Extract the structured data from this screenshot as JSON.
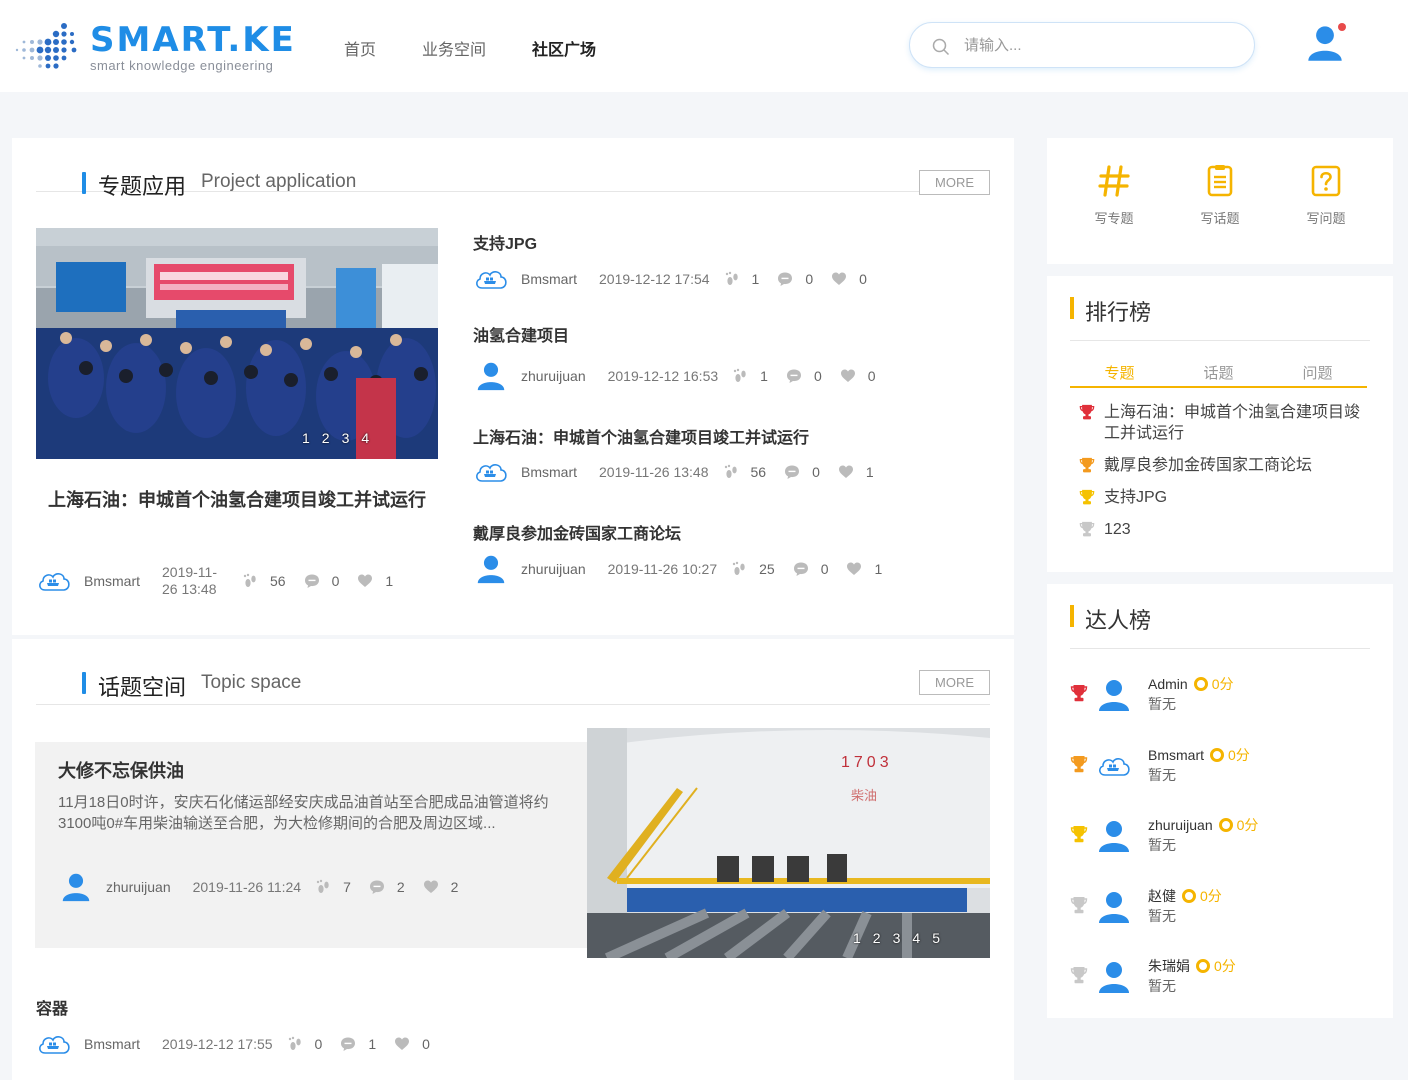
{
  "header": {
    "logo_word": "SMART.KE",
    "logo_sub": "smart  knowledge  engineering",
    "nav": [
      "首页",
      "业务空间",
      "社区广场"
    ],
    "search_placeholder": "请输入..."
  },
  "project": {
    "title": "专题应用",
    "subtitle": "Project application",
    "more": "MORE",
    "carousel_pages": [
      "1",
      "2",
      "3",
      "4"
    ],
    "featured": {
      "title": "上海石油：申城首个油氢合建项目竣工并试运行",
      "author": "Bmsmart",
      "date": "2019-11-26 13:48",
      "views": "56",
      "comments": "0",
      "likes": "1"
    },
    "items": [
      {
        "title": "支持JPG",
        "author": "Bmsmart",
        "date": "2019-12-12 17:54",
        "views": "1",
        "comments": "0",
        "likes": "0"
      },
      {
        "title": "油氢合建项目",
        "author": "zhuruijuan",
        "date": "2019-12-12 16:53",
        "views": "1",
        "comments": "0",
        "likes": "0"
      },
      {
        "title": "上海石油：申城首个油氢合建项目竣工并试运行",
        "author": "Bmsmart",
        "date": "2019-11-26 13:48",
        "views": "56",
        "comments": "0",
        "likes": "1"
      },
      {
        "title": "戴厚良参加金砖国家工商论坛",
        "author": "zhuruijuan",
        "date": "2019-11-26 10:27",
        "views": "25",
        "comments": "0",
        "likes": "1"
      }
    ]
  },
  "topic": {
    "title": "话题空间",
    "subtitle": "Topic space",
    "more": "MORE",
    "featured": {
      "title": "大修不忘保供油",
      "text": "11月18日0时许，安庆石化储运部经安庆成品油首站至合肥成品油管道将约3100吨0#车用柴油输送至合肥，为大检修期间的合肥及周边区域...",
      "author": "zhuruijuan",
      "date": "2019-11-26 11:24",
      "views": "7",
      "comments": "2",
      "likes": "2"
    },
    "photo_label_1": "1703",
    "photo_label_2": "柴油",
    "carousel_pages": [
      "1",
      "2",
      "3",
      "4",
      "5"
    ],
    "items": [
      {
        "title": "容器",
        "author": "Bmsmart",
        "date": "2019-12-12 17:55",
        "views": "0",
        "comments": "1",
        "likes": "0"
      }
    ]
  },
  "actions": [
    "写专题",
    "写话题",
    "写问题"
  ],
  "ranking": {
    "title": "排行榜",
    "tabs": [
      "专题",
      "话题",
      "问题"
    ],
    "items": [
      "上海石油：申城首个油氢合建项目竣工并试运行",
      "戴厚良参加金砖国家工商论坛",
      "支持JPG",
      "123"
    ]
  },
  "experts": {
    "title": "达人榜",
    "items": [
      {
        "name": "Admin",
        "score": "0分",
        "status": "暂无"
      },
      {
        "name": "Bmsmart",
        "score": "0分",
        "status": "暂无"
      },
      {
        "name": "zhuruijuan",
        "score": "0分",
        "status": "暂无"
      },
      {
        "name": "赵健",
        "score": "0分",
        "status": "暂无"
      },
      {
        "name": "朱瑞娟",
        "score": "0分",
        "status": "暂无"
      }
    ]
  },
  "colors": {
    "accent": "#1f8de6",
    "gold": "#f5b400",
    "trophy_1": "#e0303b",
    "trophy_2": "#f39a1f",
    "trophy_3": "#f5c200",
    "trophy_4": "#c8c8c8"
  }
}
